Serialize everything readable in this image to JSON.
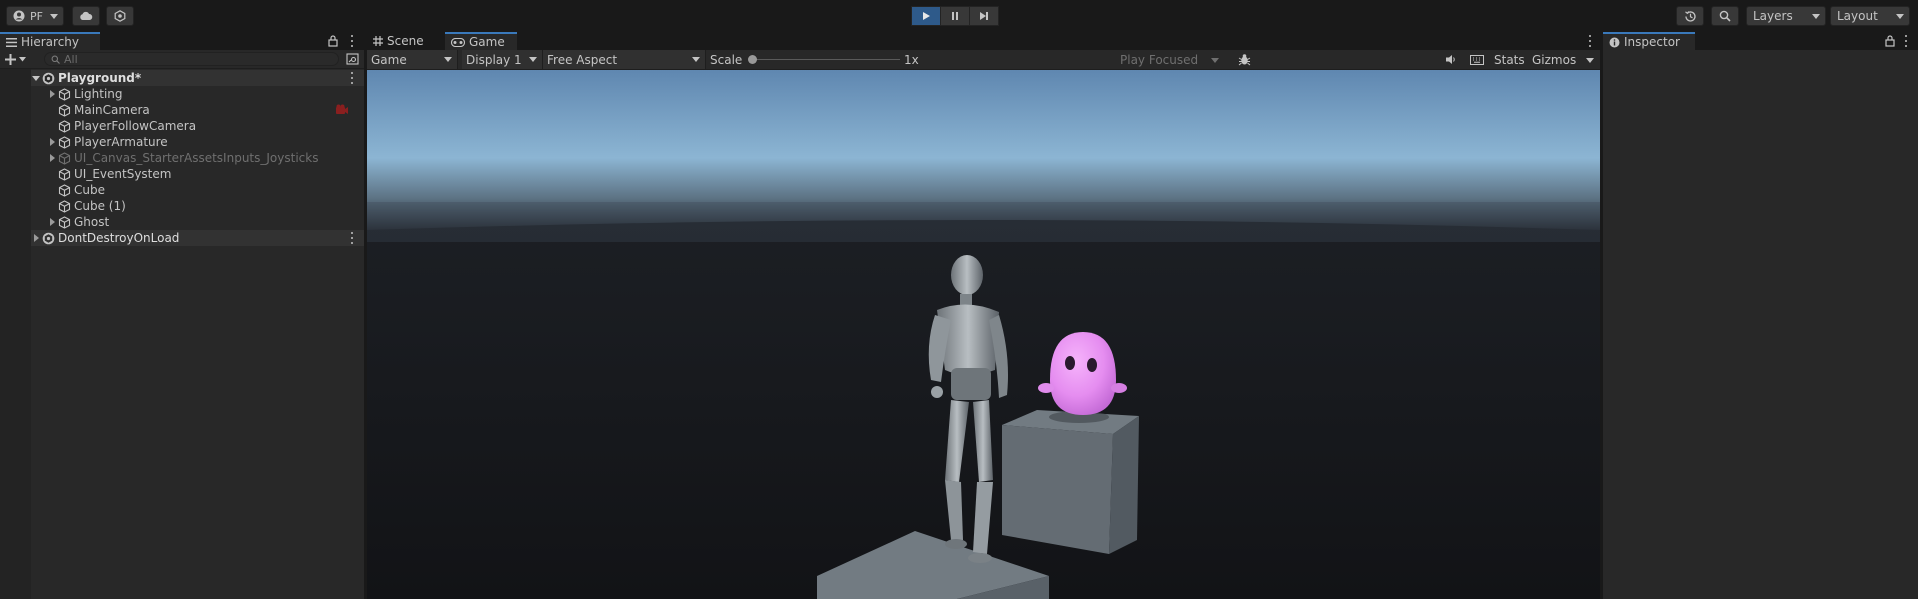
{
  "toolbar": {
    "account_label": "PF",
    "layers_label": "Layers",
    "layout_label": "Layout"
  },
  "hierarchy": {
    "tab_label": "Hierarchy",
    "search_placeholder": "All",
    "rows": [
      {
        "label": "Playground*"
      },
      {
        "label": "Lighting"
      },
      {
        "label": "MainCamera"
      },
      {
        "label": "PlayerFollowCamera"
      },
      {
        "label": "PlayerArmature"
      },
      {
        "label": "UI_Canvas_StarterAssetsInputs_Joysticks"
      },
      {
        "label": "UI_EventSystem"
      },
      {
        "label": "Cube"
      },
      {
        "label": "Cube (1)"
      },
      {
        "label": "Ghost"
      },
      {
        "label": "DontDestroyOnLoad"
      }
    ]
  },
  "center": {
    "tabs": [
      "Scene",
      "Game"
    ],
    "active_tab": "Game",
    "game_toolbar": {
      "view_mode": "Game",
      "display": "Display 1",
      "aspect": "Free Aspect",
      "scale_label": "Scale",
      "scale_value": "1x",
      "play_mode": "Play Focused",
      "stats": "Stats",
      "gizmos": "Gizmos"
    }
  },
  "inspector": {
    "tab_label": "Inspector"
  },
  "colors": {
    "accent": "#3a79bb",
    "play_active": "#2e5a8a",
    "panel": "#282828",
    "ghost": "#e58df0"
  }
}
